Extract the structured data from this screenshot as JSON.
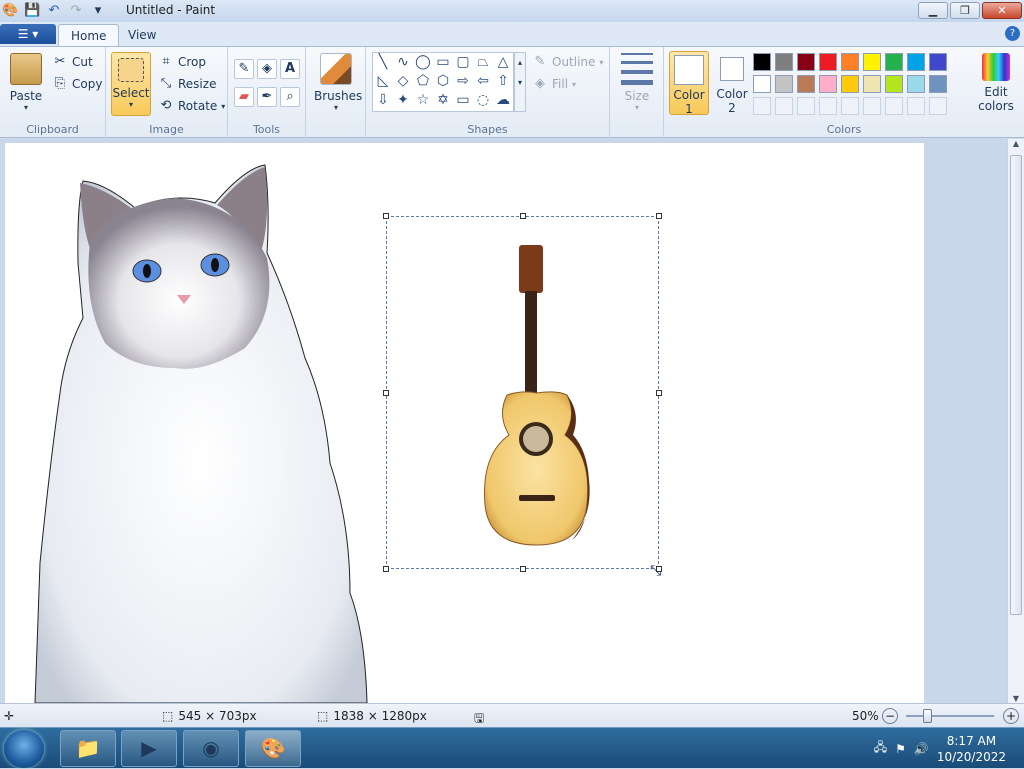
{
  "window": {
    "title": "Untitled - Paint"
  },
  "tabs": [
    "Home",
    "View"
  ],
  "clipboard": {
    "paste": "Paste",
    "cut": "Cut",
    "copy": "Copy",
    "label": "Clipboard"
  },
  "image": {
    "select": "Select",
    "crop": "Crop",
    "resize": "Resize",
    "rotate": "Rotate",
    "label": "Image"
  },
  "tools": {
    "label": "Tools"
  },
  "brushes": {
    "label": "Brushes"
  },
  "shapes": {
    "outline": "Outline",
    "fill": "Fill",
    "label": "Shapes",
    "glyphs": [
      "╲",
      "∿",
      "◯",
      "▭",
      "▢",
      "⏢",
      "△",
      "◺",
      "◇",
      "⬠",
      "⬡",
      "⇨",
      "⇦",
      "⇧",
      "⇩",
      "✦",
      "☆",
      "✡",
      "▭",
      "◌",
      "☁"
    ]
  },
  "size": {
    "label": "Size"
  },
  "colors": {
    "color1": "Color",
    "color1_num": "1",
    "color2": "Color",
    "color2_num": "2",
    "edit": "Edit",
    "edit2": "colors",
    "label": "Colors",
    "palette": [
      "#000000",
      "#7f7f7f",
      "#880015",
      "#ed1c24",
      "#ff7f27",
      "#fff200",
      "#22b14c",
      "#00a2e8",
      "#3f48cc",
      "#ffffff",
      "#c3c3c3",
      "#b97a57",
      "#ffaec9",
      "#ffc90e",
      "#efe4b0",
      "#b5e61d",
      "#99d9ea",
      "#7092be",
      "#ffffff",
      "#ffffff",
      "#ffffff",
      "#ffffff",
      "#ffffff",
      "#ffffff",
      "#ffffff",
      "#ffffff",
      "#ffffff"
    ],
    "extra": "#c8bfe7"
  },
  "status": {
    "selection": "545 × 703px",
    "image_size": "1838 × 1280px",
    "zoom": "50%"
  },
  "taskbar": {
    "time": "8:17 AM",
    "date": "10/20/2022"
  }
}
